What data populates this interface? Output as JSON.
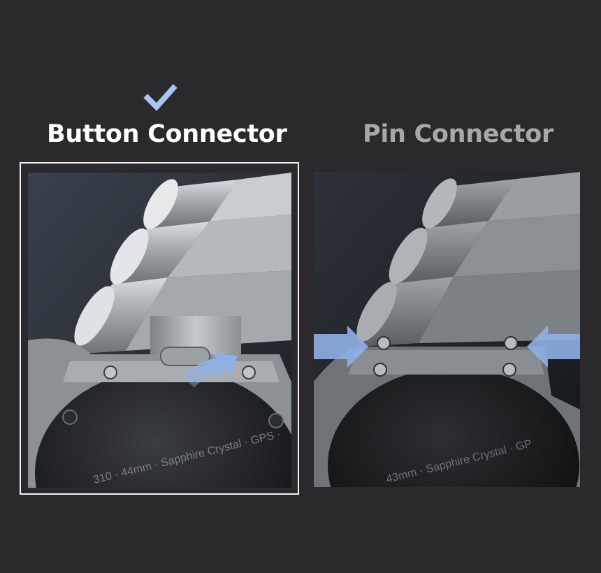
{
  "options": [
    {
      "title": "Button Connector",
      "selected": true,
      "icon": "checkmark-icon",
      "photo_caption": "",
      "engraving": "310 · 44mm · Sapphire Crystal · GPS ·"
    },
    {
      "title": "Pin Connector",
      "selected": false,
      "photo_caption": "",
      "engraving": "43mm · Sapphire Crystal · GP"
    }
  ],
  "colors": {
    "background": "#2b292c",
    "selected_text": "#ffffff",
    "unselected_text": "#a8a8aa",
    "check_accent": "#a9c4f5",
    "arrow_accent": "#8fb0e6",
    "selected_border": "#f2f2f2"
  }
}
